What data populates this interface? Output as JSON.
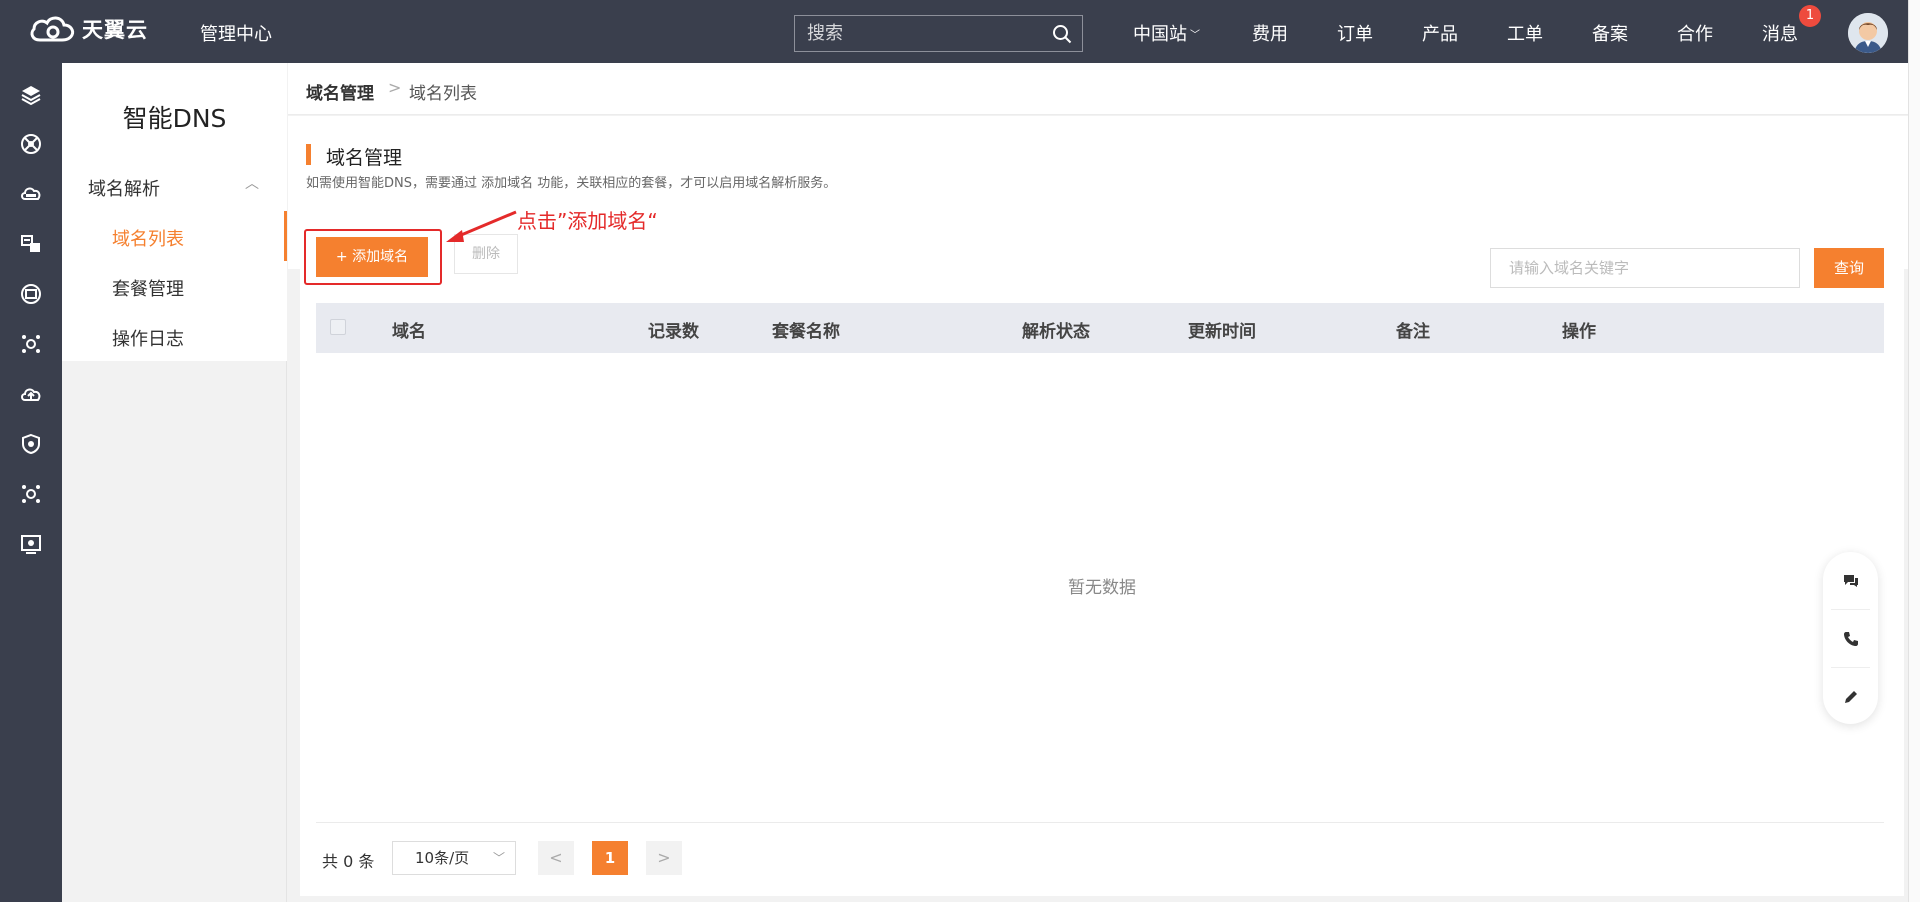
{
  "topbar": {
    "brand": "天翼云",
    "center_label": "管理中心",
    "search_placeholder": "搜索",
    "region": "中国站",
    "nav": [
      "费用",
      "订单",
      "产品",
      "工单",
      "备案",
      "合作",
      "消息"
    ],
    "message_badge": "1"
  },
  "rail": {
    "icons": [
      "layers-icon",
      "network-icon",
      "cloud-host-icon",
      "translate-icon",
      "storage-icon",
      "hub-icon",
      "cloud-upload-icon",
      "shield-icon",
      "hub-icon",
      "monitor-icon"
    ]
  },
  "sidebar": {
    "title": "智能DNS",
    "group": "域名解析",
    "items": [
      "域名列表",
      "套餐管理",
      "操作日志"
    ],
    "active_item": "域名列表"
  },
  "breadcrumb": {
    "parent": "域名管理",
    "current": "域名列表"
  },
  "header": {
    "title": "域名管理",
    "description": "如需使用智能DNS，需要通过 添加域名 功能，关联相应的套餐，才可以启用域名解析服务。"
  },
  "toolbar": {
    "add_label": "+ 添加域名",
    "delete_label": "删除",
    "annotation": "点击”添加域名“",
    "keyword_placeholder": "请输入域名关键字",
    "query_label": "查询"
  },
  "table": {
    "columns": [
      "域名",
      "记录数",
      "套餐名称",
      "解析状态",
      "更新时间",
      "备注",
      "操作"
    ],
    "rows": [],
    "empty_text": "暂无数据"
  },
  "pagination": {
    "total_text": "共 0 条",
    "page_size": "10条/页",
    "current_page": "1"
  },
  "colors": {
    "accent": "#f5802f",
    "topbar": "#3a3f4d",
    "annotation": "#e42a2a"
  }
}
